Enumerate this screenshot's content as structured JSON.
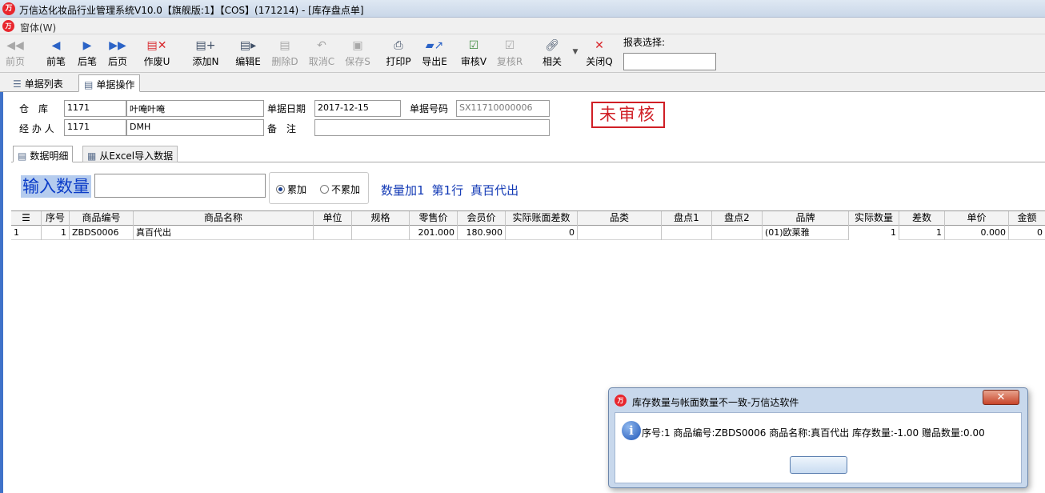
{
  "window": {
    "title": "万信达化妆品行业管理系统V10.0【旗舰版:1】【COS】(171214) - [库存盘点单]",
    "logo_text": "万"
  },
  "menu": {
    "items": [
      "窗体(W)"
    ]
  },
  "toolbar": {
    "buttons": [
      {
        "label": "前页",
        "icon": "first-page-icon"
      },
      {
        "label": "前笔",
        "icon": "prev-record-icon"
      },
      {
        "label": "后笔",
        "icon": "next-record-icon"
      },
      {
        "label": "后页",
        "icon": "last-page-icon"
      },
      {
        "label": "作废U",
        "icon": "void-icon"
      },
      {
        "label": "添加N",
        "icon": "add-icon"
      },
      {
        "label": "编辑E",
        "icon": "edit-icon"
      },
      {
        "label": "删除D",
        "icon": "delete-icon"
      },
      {
        "label": "取消C",
        "icon": "undo-icon"
      },
      {
        "label": "保存S",
        "icon": "save-icon"
      },
      {
        "label": "打印P",
        "icon": "print-icon"
      },
      {
        "label": "导出E",
        "icon": "export-icon"
      },
      {
        "label": "审核V",
        "icon": "approve-icon"
      },
      {
        "label": "复核R",
        "icon": "recheck-icon"
      },
      {
        "label": "相关",
        "icon": "link-icon"
      },
      {
        "label": "关闭Q",
        "icon": "close-icon"
      }
    ],
    "report_select_label": "报表选择:"
  },
  "tabs_top": [
    "单据列表",
    "单据操作"
  ],
  "form": {
    "warehouse_label": "仓　库",
    "warehouse_code": "1171",
    "warehouse_name": "叶唵叶唵",
    "handler_label": "经 办 人",
    "handler_code": "1171",
    "handler_name": "DMH",
    "date_label": "单据日期",
    "date_value": "2017-12-15",
    "remark_label": "备　注",
    "remark_value": "",
    "docno_label": "单据号码",
    "docno_value": "SX11710000006",
    "status_stamp": "未审核"
  },
  "tabs_detail": [
    "数据明细",
    "从Excel导入数据"
  ],
  "entry": {
    "qty_label": "输入数量",
    "qty_value": "",
    "radio_accumulate": "累加",
    "radio_no_accumulate": "不累加",
    "selected": "累加",
    "status_parts": [
      "数量加1",
      "第1行",
      "真百代出"
    ]
  },
  "grid": {
    "columns": [
      "序号",
      "商品编号",
      "商品名称",
      "单位",
      "规格",
      "零售价",
      "会员价",
      "实际账面差数",
      "品类",
      "盘点1",
      "盘点2",
      "品牌",
      "实际数量",
      "差数",
      "单价",
      "金额"
    ],
    "rows": [
      {
        "row_num": "1",
        "seq": "1",
        "code": "ZBDS0006",
        "name": "真百代出",
        "unit": "",
        "spec": "",
        "retail_price": "201.000",
        "member_price": "180.900",
        "book_diff": "0",
        "category": "",
        "count1": "",
        "count2": "",
        "brand": "(01)欧莱雅",
        "actual_qty": "1",
        "diff": "1",
        "unit_price": "0.000",
        "amount": "0"
      }
    ]
  },
  "dialog": {
    "title": "库存数量与帐面数量不一致-万信达软件",
    "message": "序号:1 商品编号:ZBDS0006  商品名称:真百代出  库存数量:-1.00 赠品数量:0.00",
    "button_label": ""
  }
}
